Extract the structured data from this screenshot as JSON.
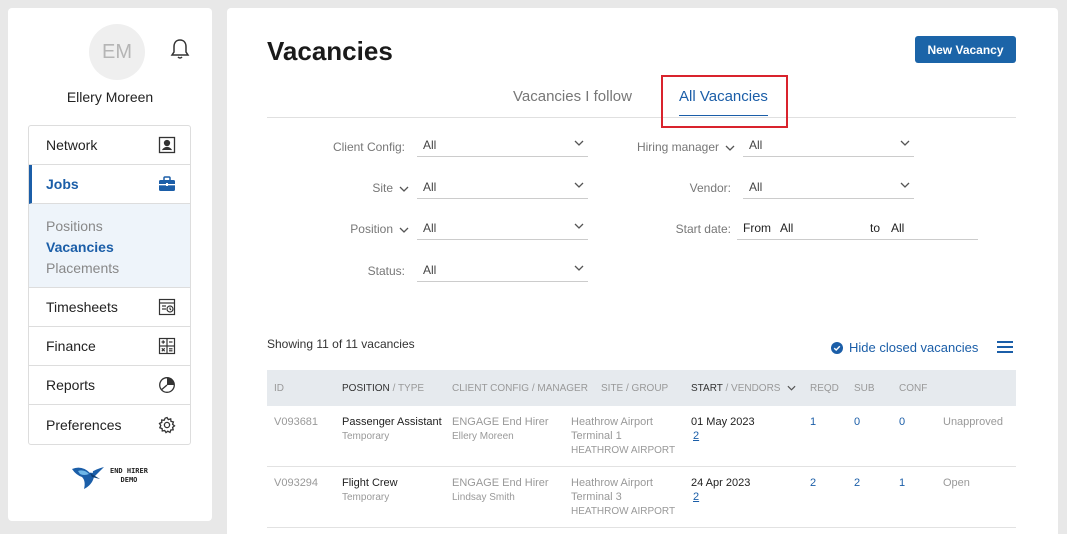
{
  "user": {
    "initials": "EM",
    "name": "Ellery Moreen"
  },
  "nav": {
    "network": "Network",
    "jobs": "Jobs",
    "sub": {
      "positions": "Positions",
      "vacancies": "Vacancies",
      "placements": "Placements"
    },
    "timesheets": "Timesheets",
    "finance": "Finance",
    "reports": "Reports",
    "preferences": "Preferences"
  },
  "logo": {
    "line1": "END HIRER",
    "line2": "DEMO"
  },
  "page": {
    "title": "Vacancies",
    "new_button": "New Vacancy"
  },
  "tabs": {
    "follow": "Vacancies I follow",
    "all": "All Vacancies"
  },
  "filters": {
    "client_config": {
      "label": "Client Config:",
      "value": "All"
    },
    "site": {
      "label": "Site",
      "value": "All"
    },
    "position": {
      "label": "Position",
      "value": "All"
    },
    "status": {
      "label": "Status:",
      "value": "All"
    },
    "hiring_manager": {
      "label": "Hiring manager",
      "value": "All"
    },
    "vendor": {
      "label": "Vendor:",
      "value": "All"
    },
    "start_date": {
      "label": "Start date:",
      "from_label": "From",
      "from_value": "All",
      "to_label": "to",
      "to_value": "All"
    }
  },
  "list": {
    "showing": "Showing 11 of 11 vacancies",
    "hide_closed": "Hide closed vacancies"
  },
  "table": {
    "headers": {
      "id": "ID",
      "position": "POSITION",
      "type": " / TYPE",
      "client_config": "CLIENT CONFIG / MANAGER",
      "site": "SITE / GROUP",
      "start": "START",
      "vendors": " / VENDORS",
      "reqd": "REQD",
      "sub": "SUB",
      "conf": "CONF"
    },
    "rows": [
      {
        "id": "V093681",
        "position": "Passenger Assistant",
        "type": "Temporary",
        "client": "ENGAGE End Hirer",
        "manager": "Ellery Moreen",
        "site": "Heathrow Airport",
        "site2": "Terminal 1",
        "group": "HEATHROW AIRPORT",
        "start": "01 May 2023",
        "vendors": "2",
        "reqd": "1",
        "sub": "0",
        "conf": "0",
        "status": "Unapproved"
      },
      {
        "id": "V093294",
        "position": "Flight Crew",
        "type": "Temporary",
        "client": "ENGAGE End Hirer",
        "manager": "Lindsay Smith",
        "site": "Heathrow Airport",
        "site2": "Terminal 3",
        "group": "HEATHROW AIRPORT",
        "start": "24 Apr 2023",
        "vendors": "2",
        "reqd": "2",
        "sub": "2",
        "conf": "1",
        "status": "Open"
      }
    ]
  },
  "colors": {
    "accent": "#1b5ea8",
    "button": "#1b64a8",
    "highlight": "#d9232d"
  }
}
